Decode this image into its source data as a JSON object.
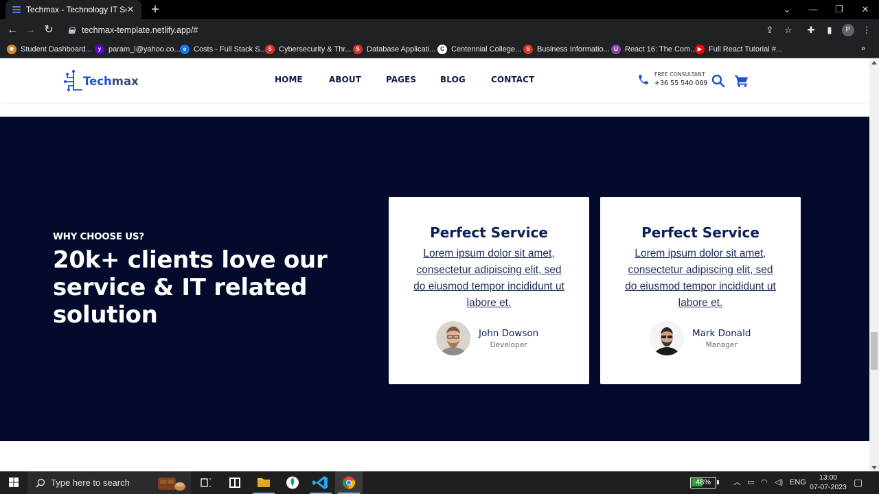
{
  "browser": {
    "tab_title": "Techmax - Technology IT Solution",
    "url": "techmax-template.netlify.app/#",
    "profile_initial": "P",
    "bookmarks": [
      {
        "label": "Student Dashboard...",
        "color": "#d58a2a",
        "glyph": "✸"
      },
      {
        "label": "param_l@yahoo.co...",
        "color": "#6001d2",
        "glyph": "y"
      },
      {
        "label": "Costs - Full Stack S...",
        "color": "#1a73e8",
        "glyph": "e"
      },
      {
        "label": "Cybersecurity & Thr...",
        "color": "#d93025",
        "glyph": "S"
      },
      {
        "label": "Database Applicati...",
        "color": "#d93025",
        "glyph": "S"
      },
      {
        "label": "Centennial College...",
        "color": "#ffffff",
        "glyph": "C"
      },
      {
        "label": "Business Informatio...",
        "color": "#d93025",
        "glyph": "S"
      },
      {
        "label": "React 16: The Com...",
        "color": "#8e44ad",
        "glyph": "U"
      },
      {
        "label": "Full React Tutorial #...",
        "color": "#ff0000",
        "glyph": "▶"
      }
    ],
    "bookmarks_more": "»"
  },
  "site": {
    "logo": {
      "part1": "Tech",
      "part2": "max"
    },
    "nav": [
      "HOME",
      "ABOUT",
      "PAGES",
      "BLOG",
      "CONTACT"
    ],
    "consult_label": "FREE CONSULTANT",
    "consult_phone": "+36 55 540 069",
    "accent": "#1d4ed8",
    "hero_bg": "#030a2c"
  },
  "hero": {
    "kicker": "WHY CHOOSE US?",
    "headline": "20k+ clients love our service & IT related solution"
  },
  "testimonials": [
    {
      "title": "Perfect Service",
      "body": "Lorem ipsum dolor sit amet, consectetur adipiscing elit, sed do eiusmod tempor incididunt ut labore et.",
      "name": "John Dowson",
      "role": "Developer"
    },
    {
      "title": "Perfect Service",
      "body": "Lorem ipsum dolor sit amet, consectetur adipiscing elit, sed do eiusmod tempor incididunt ut labore et.",
      "name": "Mark Donald",
      "role": "Manager"
    }
  ],
  "taskbar": {
    "search_placeholder": "Type here to search",
    "battery": "48%",
    "battery_level": 48,
    "language": "ENG",
    "time": "13:00",
    "date": "07-07-2023"
  }
}
